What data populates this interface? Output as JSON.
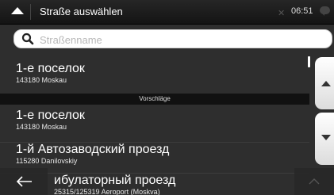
{
  "topbar": {
    "title": "Straße auswählen",
    "clock": "06:51",
    "icons": [
      "navigation-arrow-icon",
      "gps-signal-icon",
      "message-icon"
    ]
  },
  "search": {
    "placeholder": "Straßenname",
    "value": ""
  },
  "list": {
    "items": [
      {
        "name": "1-е поселок",
        "sub": "143180 Moskau"
      },
      {
        "name": "1-е поселок",
        "sub": "143180 Moskau"
      },
      {
        "name": "1-й Автозаводский проезд",
        "sub": "115280 Danilovskiy"
      },
      {
        "name": "ибулаторный проезд",
        "sub": "25315/125319 Aeroport (Moskva)"
      }
    ],
    "section_header": "Vorschläge"
  },
  "colors": {
    "background": "#2e2e2e",
    "topbar": "#1a1a1a",
    "search_field": "#ffffff",
    "side_buttons": "#f0f0f0"
  }
}
